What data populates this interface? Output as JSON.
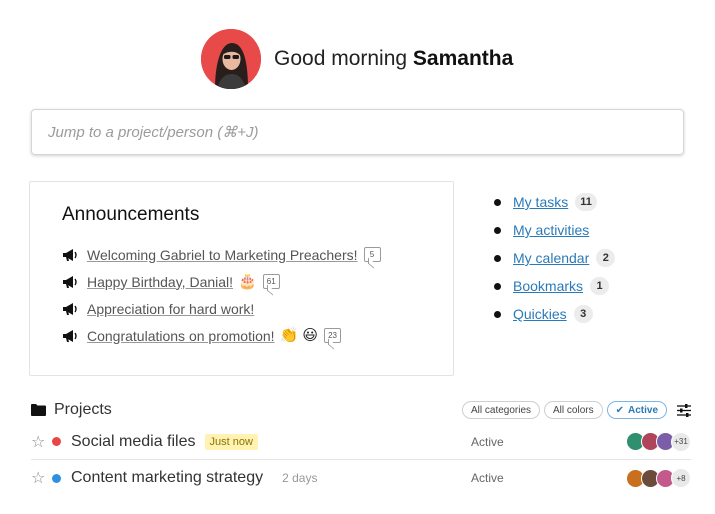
{
  "greeting": {
    "prefix": "Good morning",
    "name": "Samantha"
  },
  "search": {
    "placeholder": "Jump to a project/person (⌘+J)"
  },
  "announcements": {
    "title": "Announcements",
    "items": [
      {
        "text": "Welcoming Gabriel to Marketing Preachers!",
        "emoji": "",
        "comments": "5"
      },
      {
        "text": "Happy Birthday, Danial!",
        "emoji": "🎂",
        "comments": "61"
      },
      {
        "text": "Appreciation for hard work!",
        "emoji": "",
        "comments": ""
      },
      {
        "text": "Congratulations on promotion!",
        "emoji": "👏 😃",
        "comments": "23"
      }
    ]
  },
  "quicklinks": [
    {
      "label": "My tasks",
      "count": "11"
    },
    {
      "label": "My activities",
      "count": ""
    },
    {
      "label": "My calendar",
      "count": "2"
    },
    {
      "label": "Bookmarks",
      "count": "1"
    },
    {
      "label": "Quickies",
      "count": "3"
    }
  ],
  "projects": {
    "title": "Projects",
    "filters": {
      "categories": "All categories",
      "colors": "All colors",
      "status": "Active"
    },
    "rows": [
      {
        "name": "Social media files",
        "tag": "Just now",
        "dot_color": "#e84545",
        "status": "Active",
        "more": "+31",
        "member_colors": [
          "#2f8f6f",
          "#b0445a",
          "#7a5fa8"
        ]
      },
      {
        "name": "Content marketing strategy",
        "tag": "2 days",
        "dot_color": "#2f8fe0",
        "status": "Active",
        "more": "+8",
        "member_colors": [
          "#c8701e",
          "#6b4b3b",
          "#c45a8a"
        ]
      }
    ]
  }
}
